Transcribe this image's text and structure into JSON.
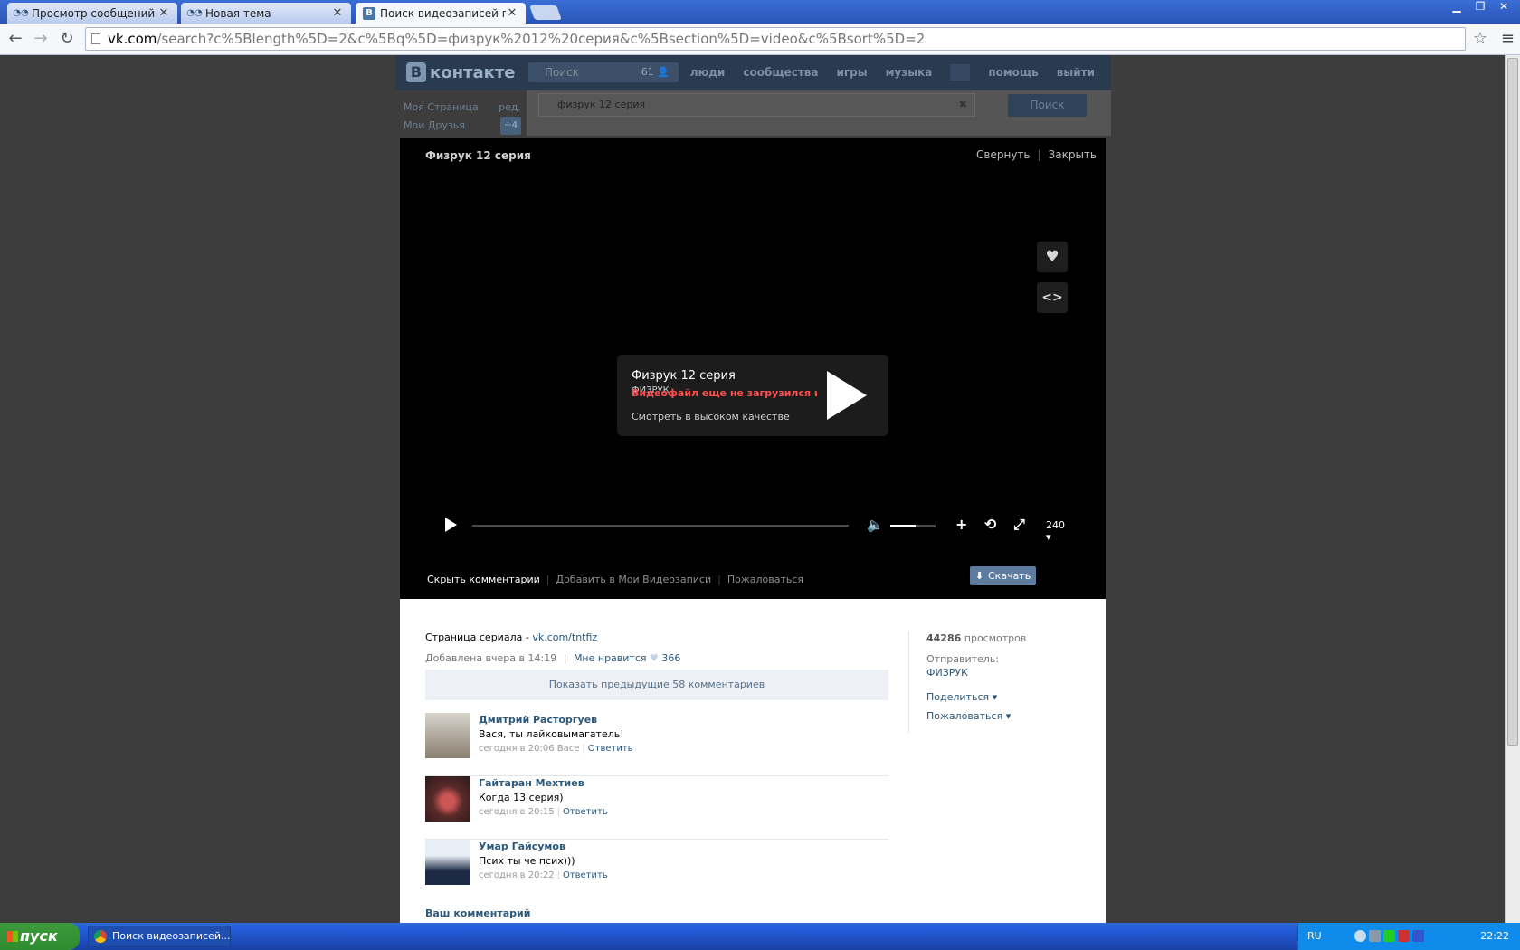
{
  "browser": {
    "tabs": [
      {
        "title": "Просмотр сообщений • Лич",
        "active": false
      },
      {
        "title": "Новая тема",
        "active": false
      },
      {
        "title": "Поиск видеозаписей по заг",
        "active": true
      }
    ],
    "url_host": "vk.com",
    "url_path": "/search?c%5Blength%5D=2&c%5Bq%5D=физрук%2012%20серия&c%5Bsection%5D=video&c%5Bsort%5D=2"
  },
  "vk_header": {
    "logo": "контакте",
    "search_placeholder": "Поиск",
    "search_count": "61",
    "nav": [
      "люди",
      "сообщества",
      "игры",
      "музыка",
      "помощь",
      "выйти"
    ]
  },
  "left_menu": {
    "my_page": "Моя Страница",
    "edit": "ред.",
    "my_friends": "Мои Друзья",
    "friends_badge": "+4"
  },
  "search": {
    "query": "физрук 12 серия",
    "button": "Поиск"
  },
  "video": {
    "title": "Физрук 12 серия",
    "minimize": "Свернуть",
    "close": "Закрыть",
    "box_title": "Физрук 12 серия",
    "box_sub": "ФИЗРУК",
    "box_error": "Видеофайл еще не загрузился или с",
    "box_hq": "Смотреть в высоком качестве",
    "quality": "240",
    "volume": 0.55,
    "hide_comments": "Скрыть комментарии",
    "add_to_videos": "Добавить в Мои Видеозаписи",
    "complain": "Пожаловаться",
    "download": "Скачать"
  },
  "info": {
    "series_label": "Страница сериала - ",
    "series_link": "vk.com/tntfiz",
    "added": "Добавлена вчера в 14:19",
    "like_label": "Мне нравится",
    "likes": "366",
    "prev_comments": "Показать предыдущие 58 комментариев",
    "comments": [
      {
        "author": "Дмитрий Расторгуев",
        "text": "Вася, ты лайковымагатель!",
        "meta": "сегодня в 20:06 Васе",
        "reply": "Ответить"
      },
      {
        "author": "Гайтаран Мехтиев",
        "text": "Когда 13 серия)",
        "meta": "сегодня в 20:15",
        "reply": "Ответить"
      },
      {
        "author": "Умар Гайсумов",
        "text": "Псих ты че псих)))",
        "meta": "сегодня в 20:22",
        "reply": "Ответить"
      }
    ],
    "your_comment": "Ваш комментарий",
    "views_count": "44286",
    "views_label": " просмотров",
    "sender_label": "Отправитель:",
    "sender": "ФИЗРУК",
    "share": "Поделиться",
    "report": "Пожаловаться"
  },
  "taskbar": {
    "start": "пуск",
    "item": "Поиск видеозаписей...",
    "lang": "RU",
    "clock": "22:22"
  }
}
